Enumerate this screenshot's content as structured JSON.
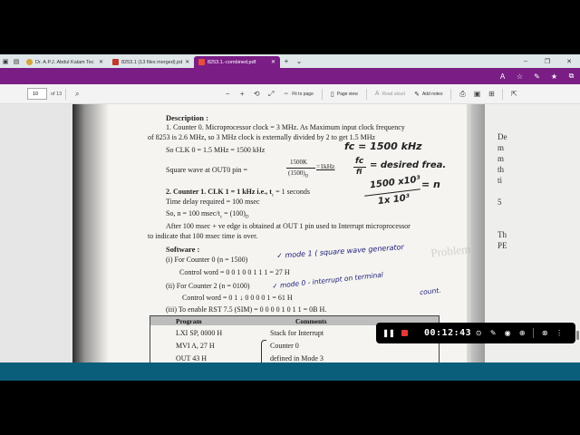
{
  "browser": {
    "tabs": [
      {
        "label": "Dr. A.P.J. Abdul Kalam Tec",
        "active": false,
        "favicon_color": "#d8a33b"
      },
      {
        "label": "8253.1 (13 files merged).pd",
        "active": false,
        "favicon_color": "#c0392b"
      },
      {
        "label": "8253.1.-combined.pdf",
        "active": true,
        "favicon_color": "#c0392b"
      }
    ],
    "new_tab_glyph": "+",
    "accent_color": "#7a1e86"
  },
  "pdf_toolbar": {
    "page_number": "10",
    "page_total": "of 13",
    "fit_to_page_label": "Fit to page",
    "page_view_label": "Page view",
    "read_aloud_label": "Read aloud",
    "add_notes_label": "Add notes"
  },
  "document": {
    "description_heading": "Description :",
    "line_counter0": "1. Counter 0. Microprocessor clock = 3 MHz. As Maximum input clock frequency",
    "line_counter0_b": "of 8253 is 2.6 MHz, so 3 MHz clock is externally divided by 2 to get 1.5 MHz",
    "line_clk0": "So CLK 0 = 1.5 MHz = 1500 kHz",
    "line_square_prefix": "Square wave at OUT0 pin =",
    "frac_num": "1500K",
    "frac_den": "(1500)",
    "frac_den_sub": "D",
    "frac_result": "=1kHz",
    "line_counter1": "2. Counter 1. CLK 1 = 1 kHz i.e., t",
    "line_counter1_sub": "c",
    "line_counter1_end": " = 1 seconds",
    "line_delay": "Time delay required = 100 msec",
    "line_n": "So, n = 100 msec/t",
    "line_n_sub": "c",
    "line_n_end": " = (100)",
    "line_n_sub2": "D",
    "line_after": "After 100 msec + ve edge is obtained at OUT 1 pin used to Interrupt microprocessor",
    "line_after_b": "to indicate that 100 msec time is over.",
    "software_heading": "Software :",
    "sw_i": "(i)     For Counter 0 (n = 1500)",
    "sw_i_cw": "Control word = 0 0 1 0 0 1 1 1 = 27 H",
    "sw_ii": "(ii)  For Counter 2 (n = 0100)",
    "sw_ii_cw": "Control word = 0 1 ↓ 0 0 0 0 1 = 61 H",
    "sw_iii": "(iii) To enable RST 7.5 (SIM) = 0 0 0 0 1 0 1 1 = 0B H.",
    "table_headers": [
      "Program",
      "Comments"
    ],
    "table_rows": [
      {
        "program": "LXI SP, 0000 H",
        "comment": "Stack for Interrupt"
      },
      {
        "program": "MVI A, 27 H",
        "comment": "Counter 0"
      },
      {
        "program": "OUT 43 H",
        "comment": "defined in Mode 3"
      }
    ],
    "ghost_text": "Problems asked in Previ"
  },
  "handwriting": {
    "fc": "fc = 1500 kHz",
    "ratio_top": "fc",
    "ratio_bot": "fi",
    "ratio_rhs": "= desired frea.",
    "eq_num": "1500 x10³",
    "eq_den": "1x 10³",
    "eq_rhs": "= n",
    "mode1": "✓  mode 1 ( square wave generator",
    "mode0": "✓  mode 0 - interrupt on terminal",
    "mode0_b": "count."
  },
  "side_page": {
    "letters": [
      "De",
      "m",
      "m",
      "th",
      "ti",
      "",
      "5",
      "",
      "",
      "Th",
      "PE"
    ]
  },
  "recorder": {
    "timer": "00:12:43"
  }
}
